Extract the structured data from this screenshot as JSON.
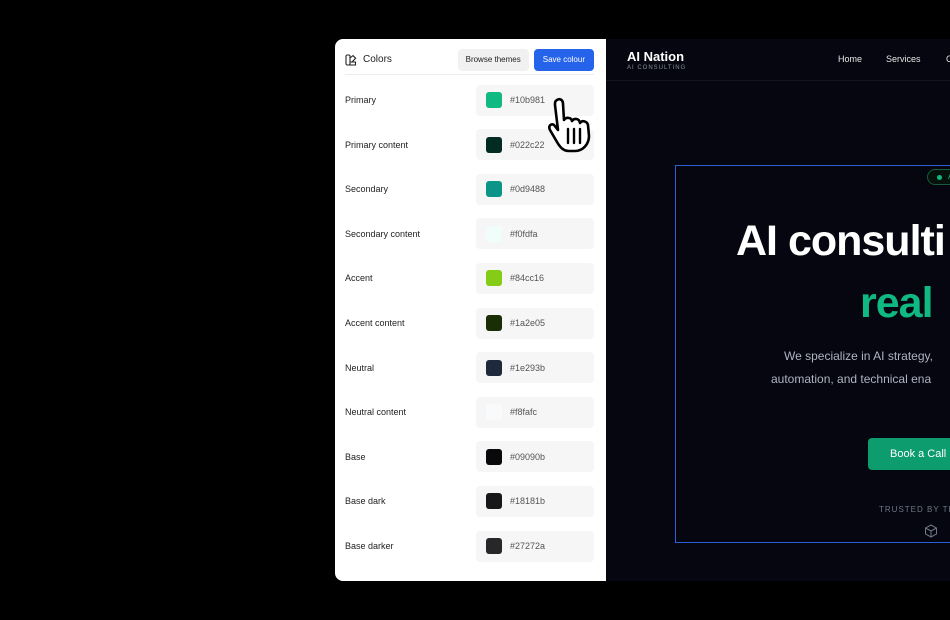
{
  "panel": {
    "title": "Colors",
    "browse_label": "Browse themes",
    "save_label": "Save colour",
    "colors": [
      {
        "label": "Primary",
        "hex": "#10b981"
      },
      {
        "label": "Primary content",
        "hex": "#022c22"
      },
      {
        "label": "Secondary",
        "hex": "#0d9488"
      },
      {
        "label": "Secondary content",
        "hex": "#f0fdfa"
      },
      {
        "label": "Accent",
        "hex": "#84cc16"
      },
      {
        "label": "Accent content",
        "hex": "#1a2e05"
      },
      {
        "label": "Neutral",
        "hex": "#1e293b"
      },
      {
        "label": "Neutral content",
        "hex": "#f8fafc"
      },
      {
        "label": "Base",
        "hex": "#09090b"
      },
      {
        "label": "Base dark",
        "hex": "#18181b"
      },
      {
        "label": "Base darker",
        "hex": "#27272a"
      }
    ]
  },
  "preview": {
    "brand": "AI Nation",
    "brand_sub": "AI CONSULTING",
    "nav": [
      "Home",
      "Services",
      "C"
    ],
    "badge": "A",
    "hero_title": "AI consulti",
    "hero_accent": "real",
    "hero_desc_1": "We specialize in AI strategy,",
    "hero_desc_2": "automation, and technical ena",
    "cta": "Book a Call",
    "trusted": "TRUSTED BY TE"
  }
}
